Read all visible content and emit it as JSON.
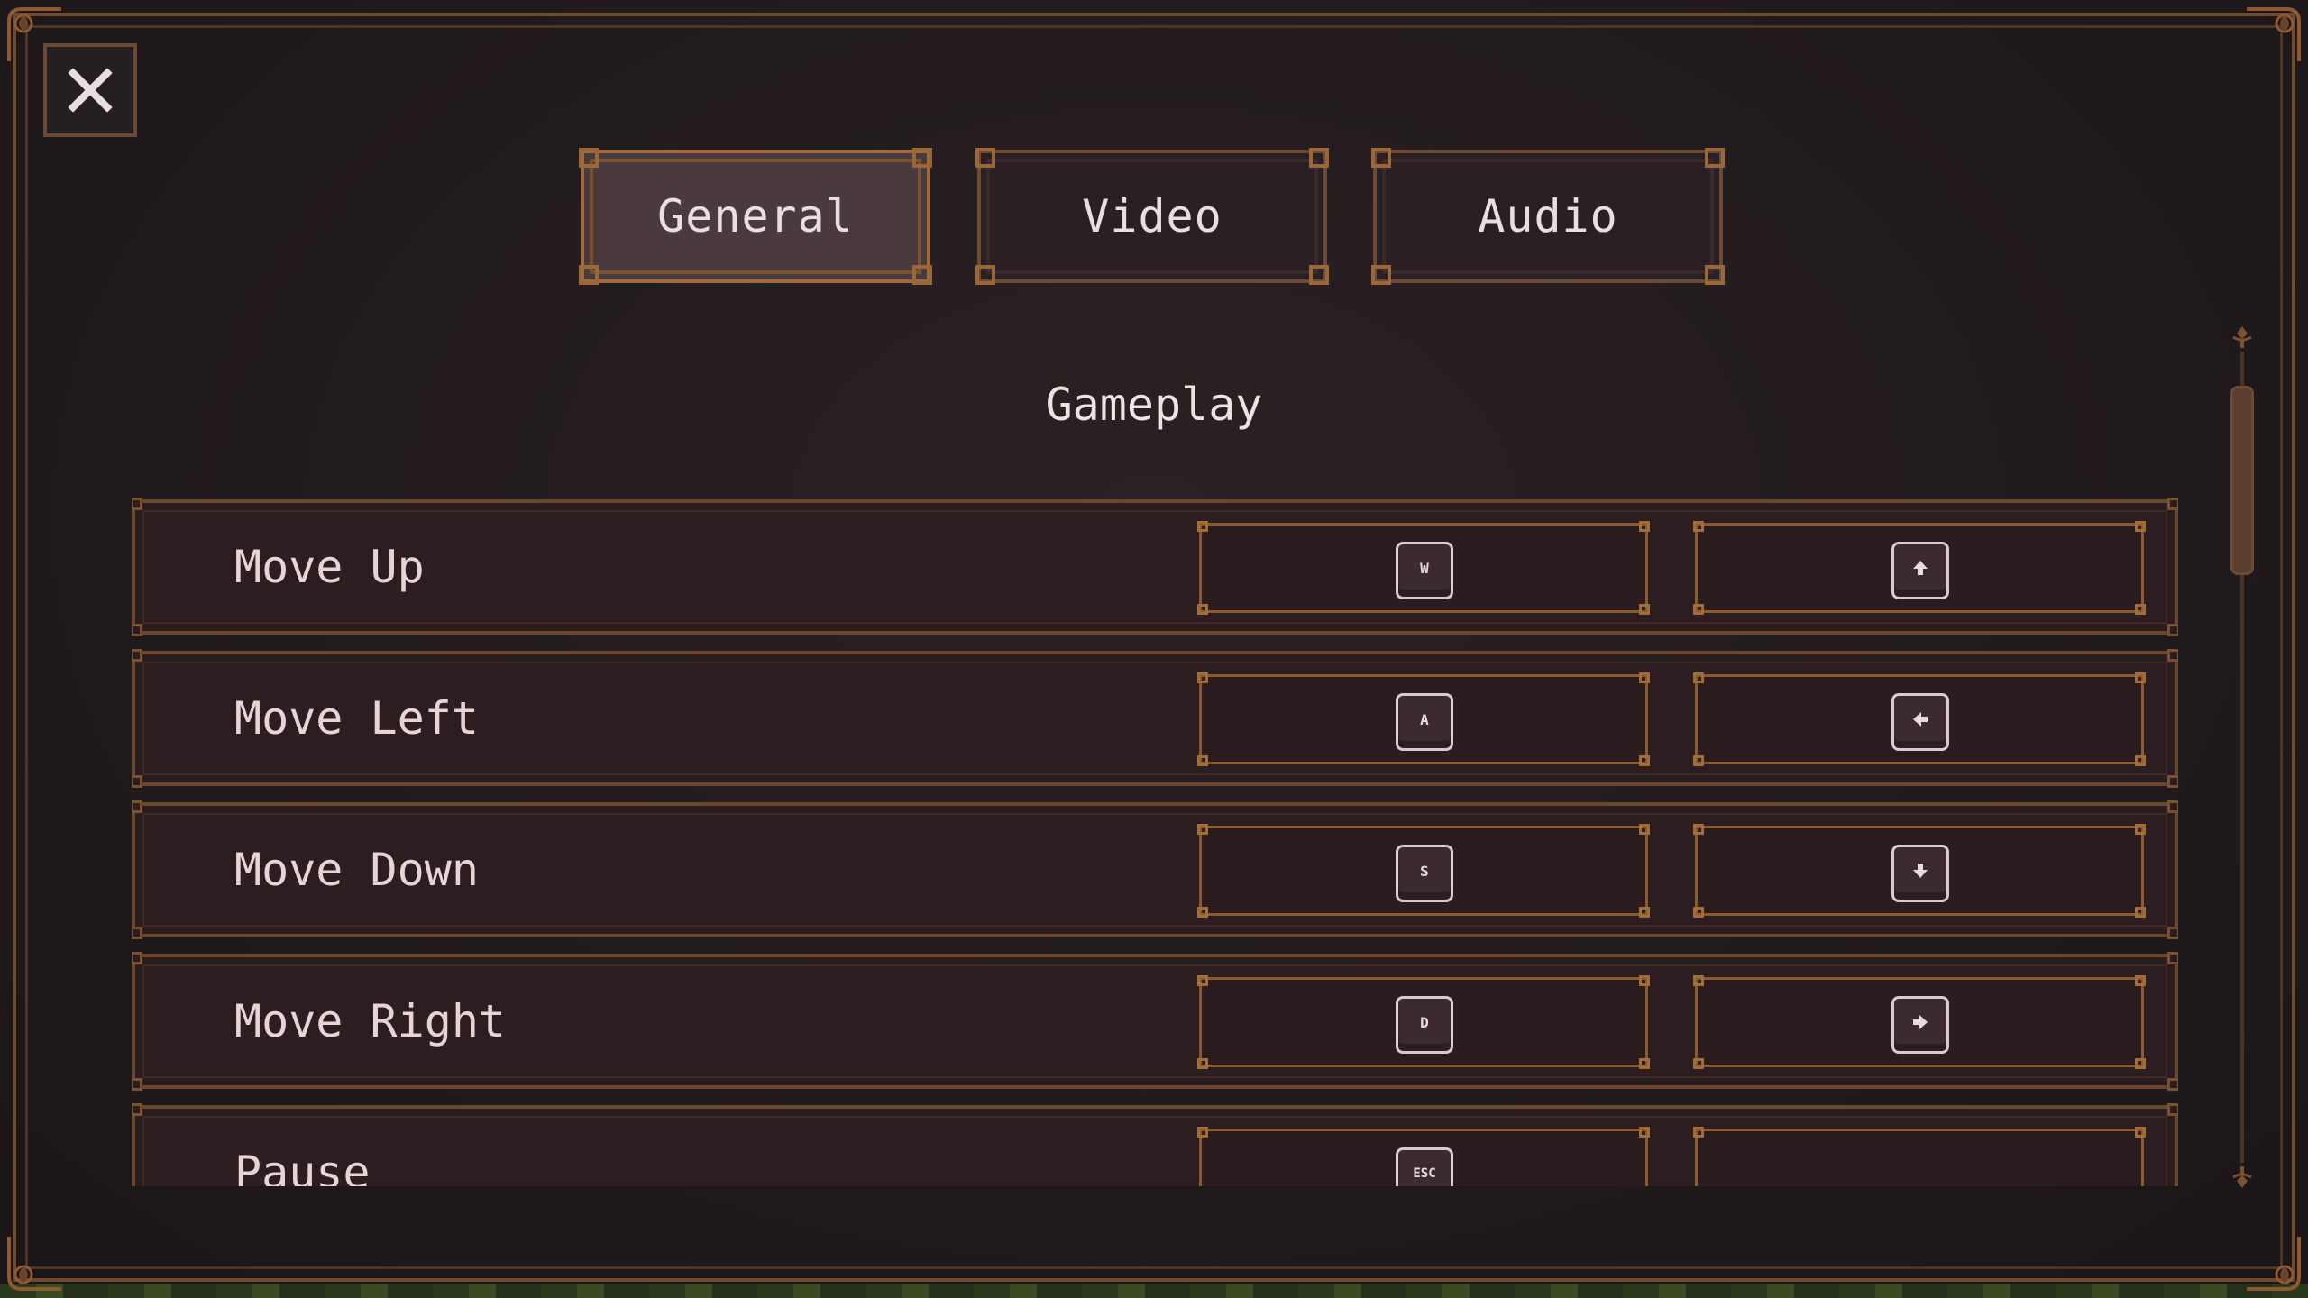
{
  "tabs": [
    {
      "label": "General",
      "active": true
    },
    {
      "label": "Video",
      "active": false
    },
    {
      "label": "Audio",
      "active": false
    }
  ],
  "section_title": "Gameplay",
  "bindings": [
    {
      "action": "Move Up",
      "primary_key": "W",
      "secondary_key": "arrow-up"
    },
    {
      "action": "Move Left",
      "primary_key": "A",
      "secondary_key": "arrow-left"
    },
    {
      "action": "Move Down",
      "primary_key": "S",
      "secondary_key": "arrow-down"
    },
    {
      "action": "Move Right",
      "primary_key": "D",
      "secondary_key": "arrow-right"
    },
    {
      "action": "Pause",
      "primary_key": "ESC",
      "secondary_key": ""
    }
  ],
  "icons": {
    "close": "close-icon",
    "scroll_top": "fleur-icon",
    "scroll_bottom": "fleur-icon"
  },
  "colors": {
    "accent_border": "#8a5a30",
    "row_background": "#2c1d20",
    "active_tab": "#4a3a3e",
    "text": "#e8d3d6"
  }
}
